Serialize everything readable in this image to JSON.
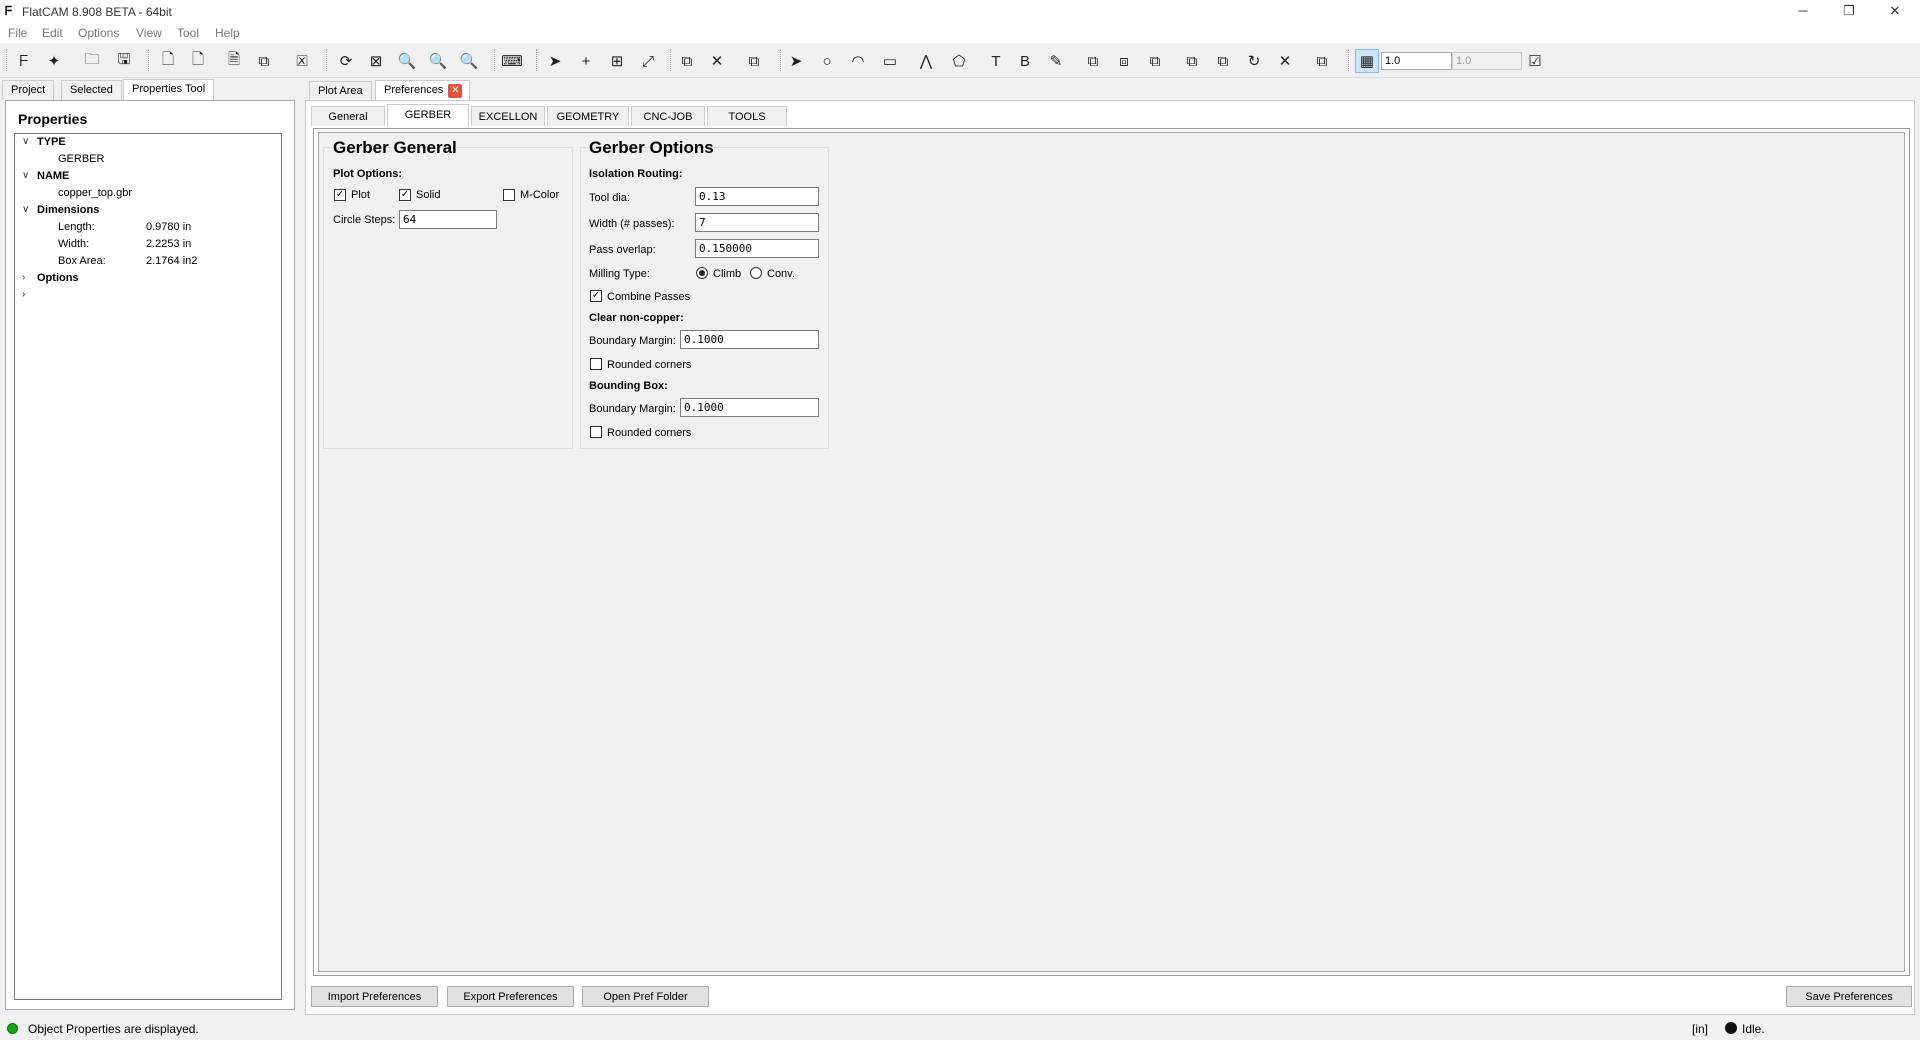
{
  "window": {
    "title": "FlatCAM 8.908 BETA - 64bit",
    "minimize": "─",
    "restore": "❐",
    "close": "✕"
  },
  "menu": [
    "File",
    "Edit",
    "Options",
    "View",
    "Tool",
    "Help"
  ],
  "toolbar": {
    "grid_x": "1.0",
    "grid_y": "1.0"
  },
  "left_tabs": [
    "Project",
    "Selected",
    "Properties Tool"
  ],
  "properties": {
    "title": "Properties",
    "type_label": "TYPE",
    "type_value": "GERBER",
    "name_label": "NAME",
    "name_value": "copper_top.gbr",
    "dimensions_label": "Dimensions",
    "length_label": "Length:",
    "length_value": "0.9780 in",
    "width_label": "Width:",
    "width_value": "2.2253 in",
    "box_area_label": "Box Area:",
    "box_area_value": "2.1764 in2",
    "options_label": "Options"
  },
  "main_tabs": [
    "Plot Area",
    "Preferences"
  ],
  "pref_tabs": [
    "General",
    "GERBER",
    "EXCELLON",
    "GEOMETRY",
    "CNC-JOB",
    "TOOLS"
  ],
  "gerber_general": {
    "title": "Gerber General",
    "plot_options": "Plot Options:",
    "plot": "Plot",
    "solid": "Solid",
    "mcolor": "M-Color",
    "circle_steps_label": "Circle Steps:",
    "circle_steps": "64"
  },
  "gerber_options": {
    "title": "Gerber Options",
    "isolation_routing": "Isolation Routing:",
    "tool_dia_label": "Tool dia:",
    "tool_dia": "0.13",
    "width_passes_label": "Width (# passes):",
    "width_passes": "7",
    "pass_overlap_label": "Pass overlap:",
    "pass_overlap": "0.150000",
    "milling_type_label": "Milling Type:",
    "climb": "Climb",
    "conv": "Conv.",
    "combine_passes": "Combine Passes",
    "clear_non_copper": "Clear non-copper:",
    "boundary_margin_label": "Boundary Margin:",
    "boundary_margin_1": "0.1000",
    "rounded_corners": "Rounded corners",
    "bounding_box": "Bounding Box:",
    "boundary_margin_2": "0.1000"
  },
  "buttons": {
    "import": "Import Preferences",
    "export": "Export Preferences",
    "open_folder": "Open Pref Folder",
    "save": "Save Preferences"
  },
  "status": {
    "message": "Object Properties are displayed.",
    "units": "[in]",
    "state": "Idle."
  },
  "colors": {
    "status_ok": "#1aa31a",
    "close_tab": "#e0533c",
    "selected_tool": "#cde3f7"
  }
}
